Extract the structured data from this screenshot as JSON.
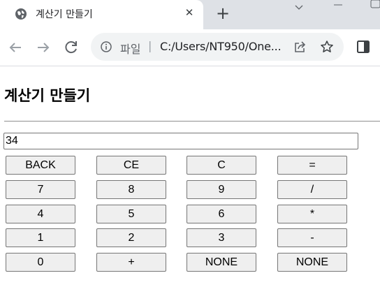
{
  "browser": {
    "tab": {
      "title": "계산기 만들기",
      "favicon": "globe-icon",
      "close_icon": "close-icon",
      "close_symbol": "✕"
    },
    "new_tab_symbol": "+",
    "toolbar": {
      "back_icon": "back-arrow-icon",
      "forward_icon": "forward-arrow-icon",
      "reload_icon": "reload-icon",
      "address": {
        "info_icon": "info-icon",
        "scheme_label": "파일",
        "separator": "|",
        "url": "C:/Users/NT950/One..."
      },
      "share_icon": "share-icon",
      "bookmark_icon": "star-icon",
      "side_panel_icon": "side-panel-icon"
    }
  },
  "page": {
    "heading": "계산기 만들기",
    "display": {
      "value": "34"
    },
    "keys": [
      [
        "BACK",
        "CE",
        "C",
        "="
      ],
      [
        "7",
        "8",
        "9",
        "/"
      ],
      [
        "4",
        "5",
        "6",
        "*"
      ],
      [
        "1",
        "2",
        "3",
        "-"
      ],
      [
        "0",
        "+",
        "NONE",
        "NONE"
      ]
    ]
  }
}
